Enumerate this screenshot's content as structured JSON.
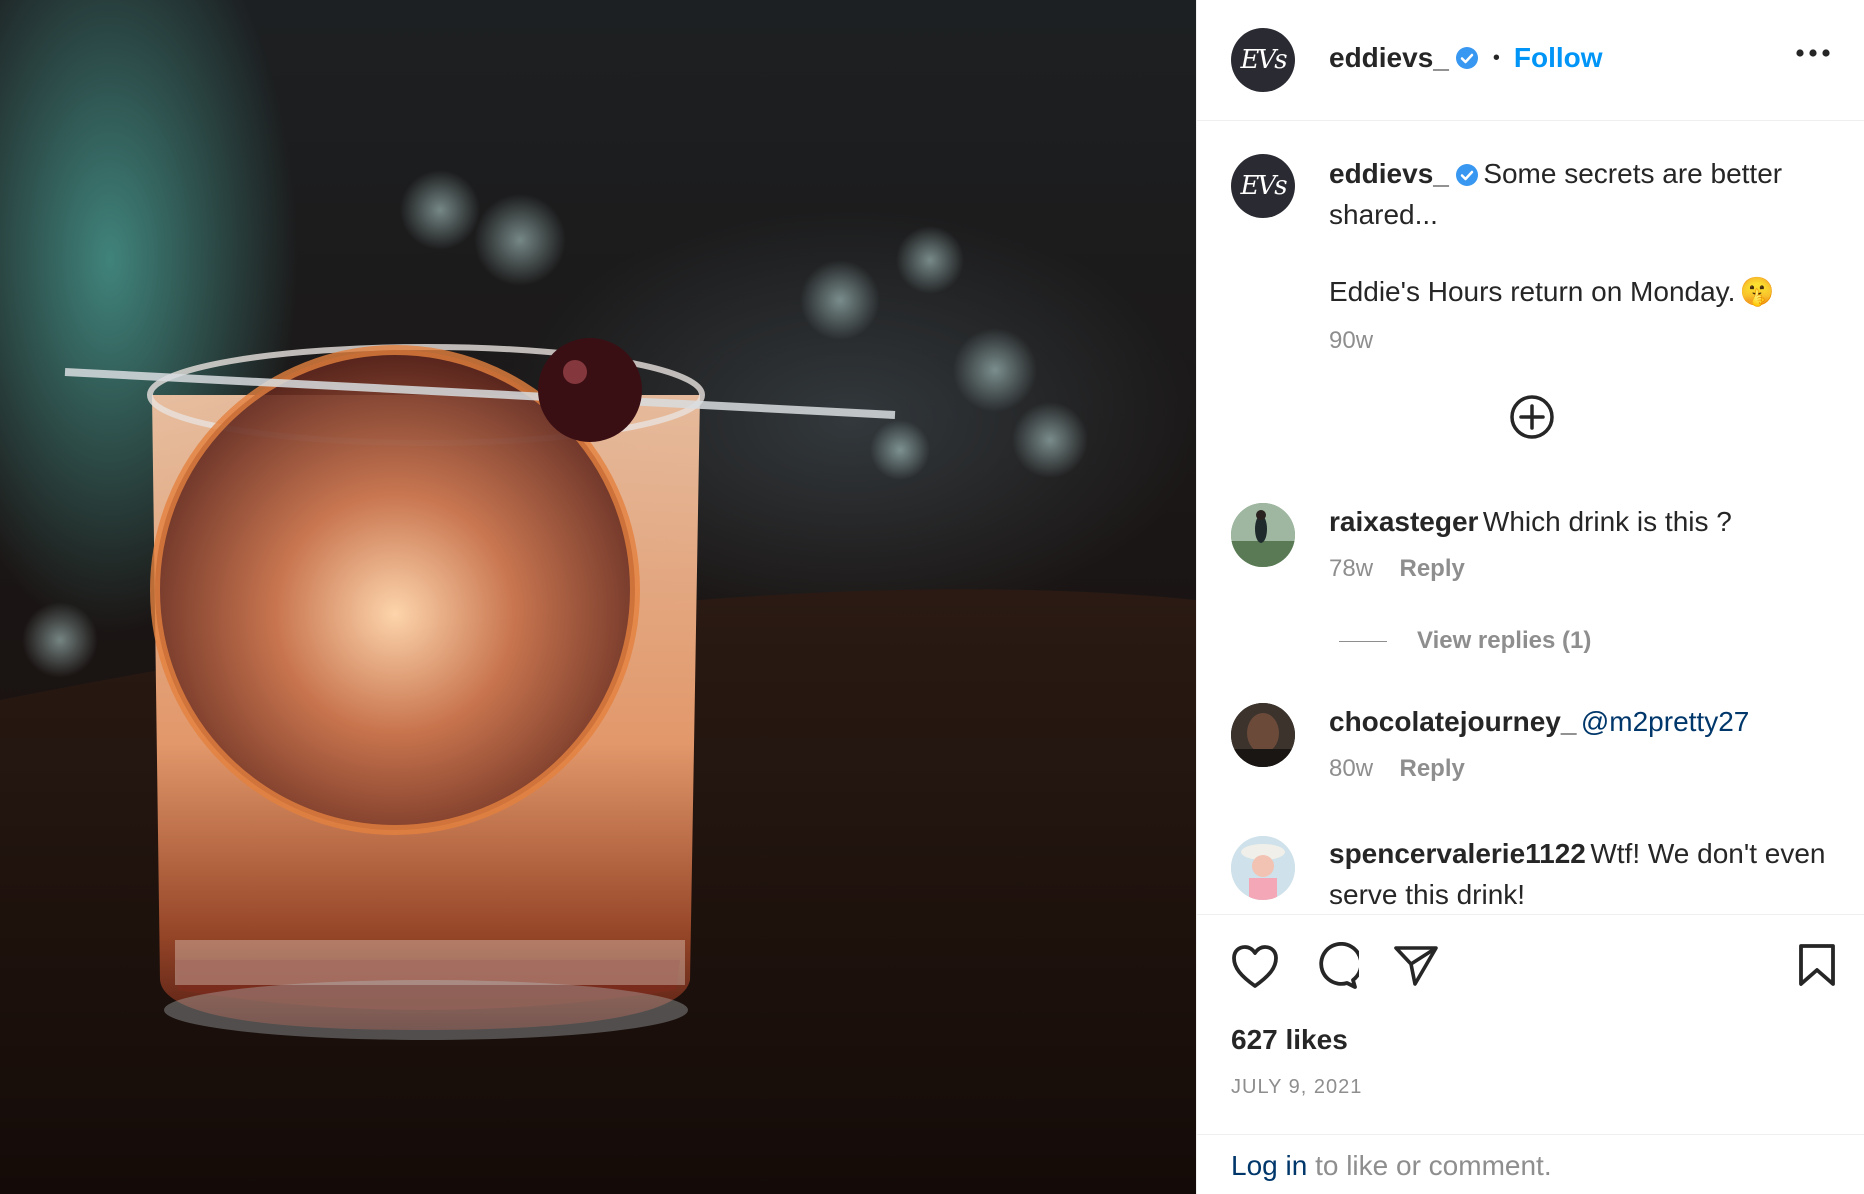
{
  "header": {
    "username": "eddievs_",
    "dot": "•",
    "follow_label": "Follow",
    "more_icon": "more-horizontal-icon",
    "avatar_text": "EVs"
  },
  "caption": {
    "username": "eddievs_",
    "text_1": "Some secrets are better shared...",
    "text_2": "Eddie's Hours return on Monday.",
    "emoji": "🤫",
    "time": "90w"
  },
  "load_more_icon": "plus-circle-icon",
  "comments": [
    {
      "username": "raixasteger",
      "text": "Which drink is this ?",
      "time": "78w",
      "reply_label": "Reply",
      "view_replies": "View replies (1)"
    },
    {
      "username": "chocolatejourney_",
      "mention": "@m2pretty27",
      "time": "80w",
      "reply_label": "Reply"
    },
    {
      "username": "spencervalerie1122",
      "text": "Wtf! We don't even serve this drink!"
    }
  ],
  "actions": {
    "like_icon": "heart-icon",
    "comment_icon": "comment-icon",
    "share_icon": "paper-plane-icon",
    "save_icon": "bookmark-icon"
  },
  "likes": "627 likes",
  "date": "JULY 9, 2021",
  "login": {
    "link": "Log in",
    "rest": "to like or comment."
  },
  "colors": {
    "accent": "#0095f6",
    "verified": "#3897f0",
    "link": "#00376b",
    "muted": "#8e8e8e",
    "divider": "#efefef"
  }
}
